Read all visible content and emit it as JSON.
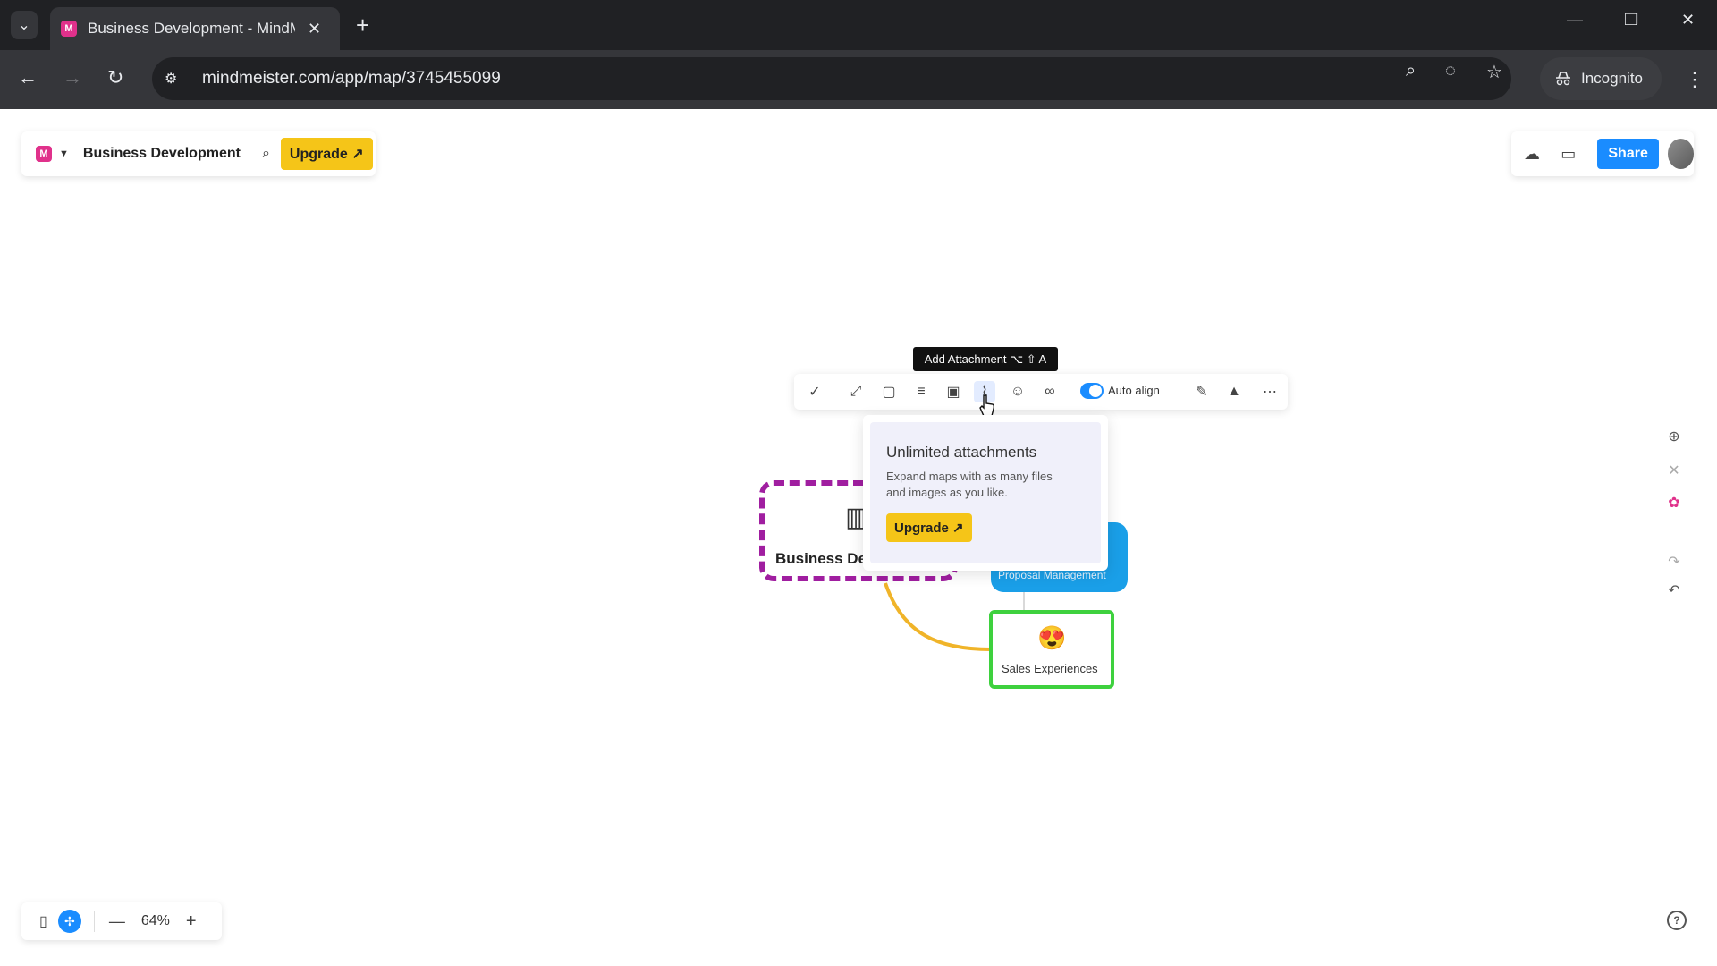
{
  "browser": {
    "tab_title": "Business Development - MindMeister",
    "tab_favicon": "M",
    "url": "mindmeister.com/app/map/3745455099",
    "incognito_label": "Incognito"
  },
  "app": {
    "logo_letter": "M",
    "map_title": "Business Development",
    "upgrade_label": "Upgrade ↗",
    "share_label": "Share"
  },
  "toolbar": {
    "tooltip": "Add Attachment ⌥ ⇧ A",
    "auto_align_label": "Auto align",
    "auto_align_on": true
  },
  "popover": {
    "title": "Unlimited attachments",
    "description": "Expand maps with as many files and images as you like.",
    "button_label": "Upgrade ↗"
  },
  "nodes": {
    "root_label": "Business De",
    "blue_label": "Proposal Management",
    "green_label": "Sales Experiences",
    "green_emoji": "😍"
  },
  "bottom_bar": {
    "zoom": "64%"
  },
  "colors": {
    "accent": "#1a8cff",
    "upgrade": "#f5c518",
    "root_border": "#a01ea0",
    "blue_node": "#1a9fe8",
    "green_border": "#3ed13e",
    "connector": "#f0b429"
  }
}
